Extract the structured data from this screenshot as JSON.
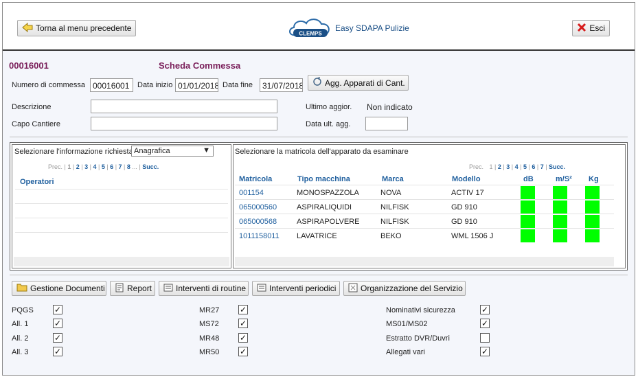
{
  "header": {
    "back_label": "Torna al menu precedente",
    "logo_text": "CLEMPS",
    "app_title": "Easy SDAPA Pulizie",
    "exit_label": "Esci"
  },
  "commessa": {
    "code": "00016001",
    "title": "Scheda Commessa",
    "numero_label": "Numero di commessa",
    "numero_value": "00016001",
    "data_inizio_label": "Data inizio",
    "data_inizio_value": "01/01/2018",
    "data_fine_label": "Data fine",
    "data_fine_value": "31/07/2018",
    "agg_button": "Agg. Apparati di Cant.",
    "descrizione_label": "Descrizione",
    "capo_label": "Capo Cantiere",
    "ultimo_aggior_label": "Ultimo aggior.",
    "ultimo_aggior_value": "Non indicato",
    "data_ult_agg_label": "Data ult. agg."
  },
  "left_panel": {
    "select_label": "Selezionare l'informazione richiesta",
    "select_value": "Anagrafica",
    "pager_prev": "Prec.",
    "pages": [
      "1",
      "2",
      "3",
      "4",
      "5",
      "6",
      "7",
      "8",
      "..."
    ],
    "pager_next": "Succ.",
    "column": "Operatori"
  },
  "right_panel": {
    "title": "Selezionare la matricola dell'apparato da esaminare",
    "pager_prev": "Prec.",
    "pages": [
      "1",
      "2",
      "3",
      "4",
      "5",
      "6",
      "7"
    ],
    "pager_next": "Succ.",
    "headers": [
      "Matricola",
      "Tipo macchina",
      "Marca",
      "Modello",
      "dB",
      "m/S²",
      "Kg"
    ],
    "rows": [
      {
        "matricola": "001154",
        "tipo": "MONOSPAZZOLA",
        "marca": "NOVA",
        "modello": "ACTIV 17"
      },
      {
        "matricola": "065000560",
        "tipo": "ASPIRALIQUIDI",
        "marca": "NILFISK",
        "modello": "GD 910"
      },
      {
        "matricola": "065000568",
        "tipo": "ASPIRAPOLVERE",
        "marca": "NILFISK",
        "modello": "GD 910"
      },
      {
        "matricola": "1011158011",
        "tipo": "LAVATRICE",
        "marca": "BEKO",
        "modello": "WML 1506 J"
      }
    ],
    "indicator_color": "#00ff00"
  },
  "toolbar": {
    "gestione": "Gestione Documenti",
    "report": "Report",
    "routine": "Interventi di routine",
    "periodici": "Interventi periodici",
    "organizzazione": "Organizzazione del Servizio"
  },
  "checks": {
    "col1": [
      {
        "label": "PQGS",
        "checked": true
      },
      {
        "label": "All. 1",
        "checked": true
      },
      {
        "label": "All. 2",
        "checked": true
      },
      {
        "label": "All. 3",
        "checked": true
      }
    ],
    "col2": [
      {
        "label": "MR27",
        "checked": true
      },
      {
        "label": "MS72",
        "checked": true
      },
      {
        "label": "MR48",
        "checked": true
      },
      {
        "label": "MR50",
        "checked": true
      }
    ],
    "col3": [
      {
        "label": "Nominativi sicurezza",
        "checked": true
      },
      {
        "label": "MS01/MS02",
        "checked": true
      },
      {
        "label": "Estratto DVR/Duvri",
        "checked": false
      },
      {
        "label": "Allegati vari",
        "checked": true
      }
    ]
  },
  "colors": {
    "accent": "#7a1f5a",
    "link": "#1f5f9e"
  }
}
